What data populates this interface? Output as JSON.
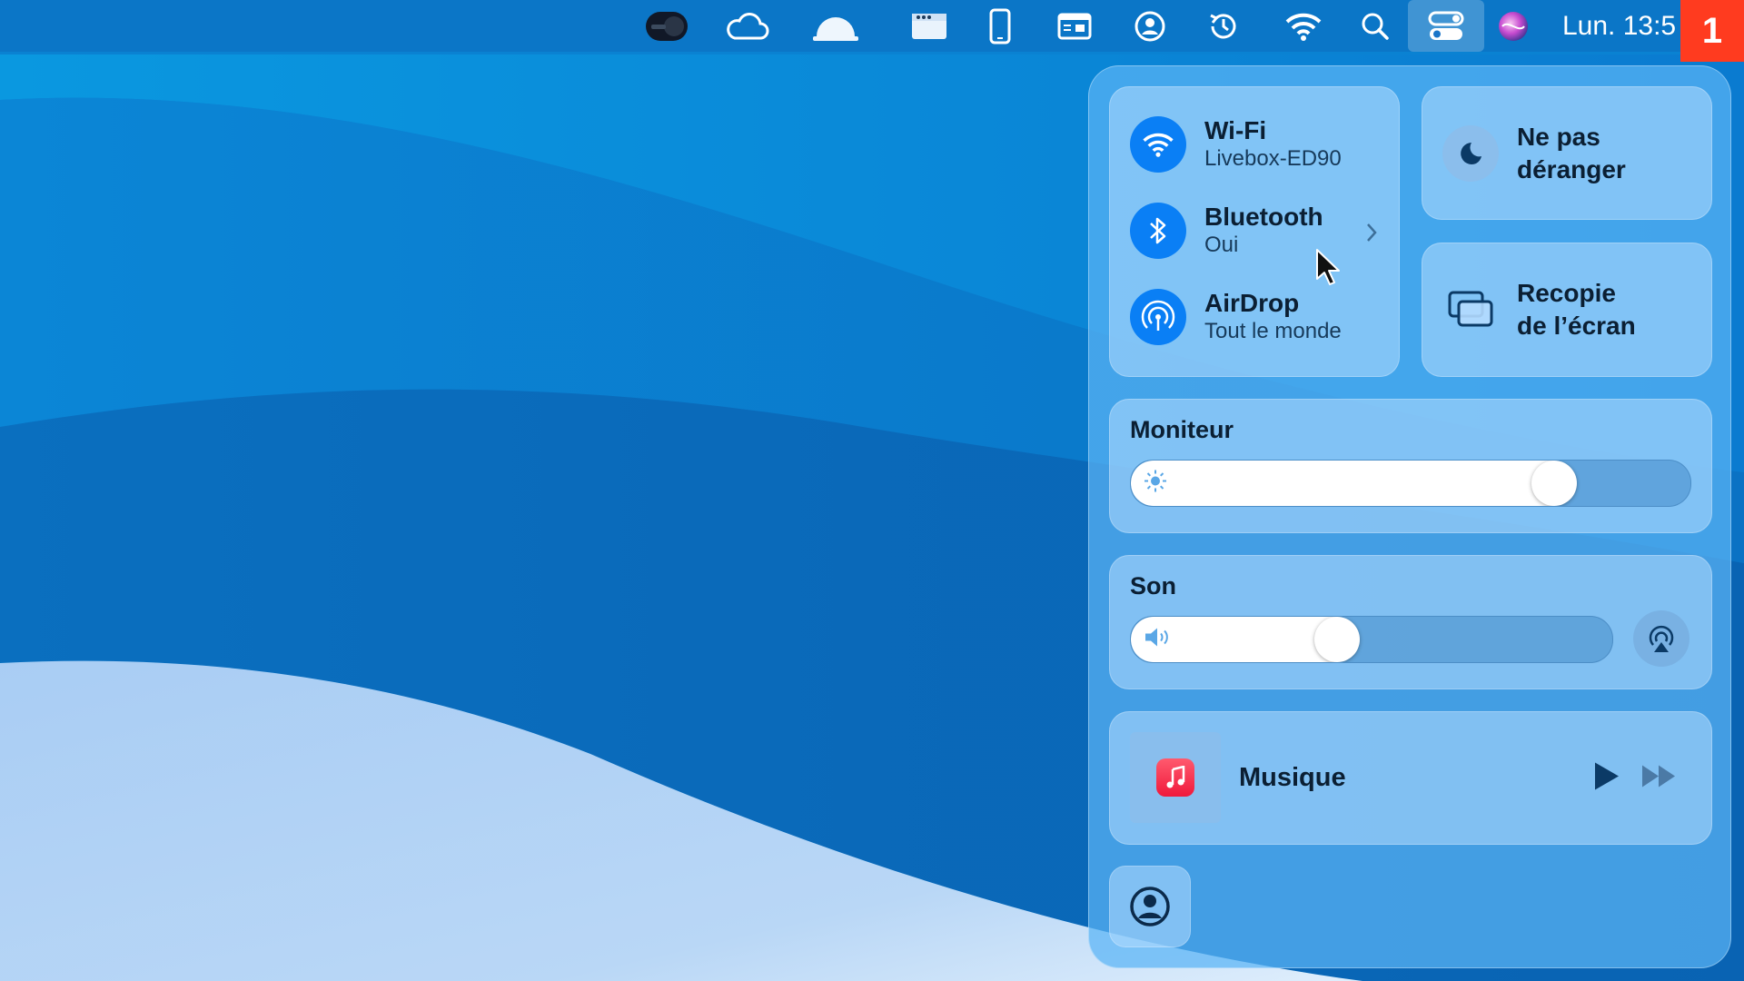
{
  "menubar": {
    "clock": "Lun. 13:5",
    "notification_badge": "1",
    "icons": [
      "toggle-icon",
      "cloud-icon",
      "dome-icon",
      "window-icon",
      "iphone-icon",
      "keyboard-viewer-icon",
      "user-circle-icon",
      "time-machine-icon",
      "wifi-icon",
      "search-icon",
      "control-center-icon",
      "siri-icon"
    ]
  },
  "control_center": {
    "connectivity": {
      "wifi": {
        "title": "Wi-Fi",
        "subtitle": "Livebox-ED90"
      },
      "bluetooth": {
        "title": "Bluetooth",
        "subtitle": "Oui"
      },
      "airdrop": {
        "title": "AirDrop",
        "subtitle": "Tout le monde"
      }
    },
    "do_not_disturb": {
      "label_line1": "Ne pas",
      "label_line2": "déranger"
    },
    "screen_mirroring": {
      "label_line1": "Recopie",
      "label_line2": "de l’écran"
    },
    "display": {
      "title": "Moniteur",
      "brightness_percent": 78
    },
    "sound": {
      "title": "Son",
      "volume_percent": 42
    },
    "now_playing": {
      "title": "Musique"
    }
  },
  "colors": {
    "accent": "#0a7ff5",
    "badge": "#ff3b1f",
    "music_red": "#f0193c"
  }
}
